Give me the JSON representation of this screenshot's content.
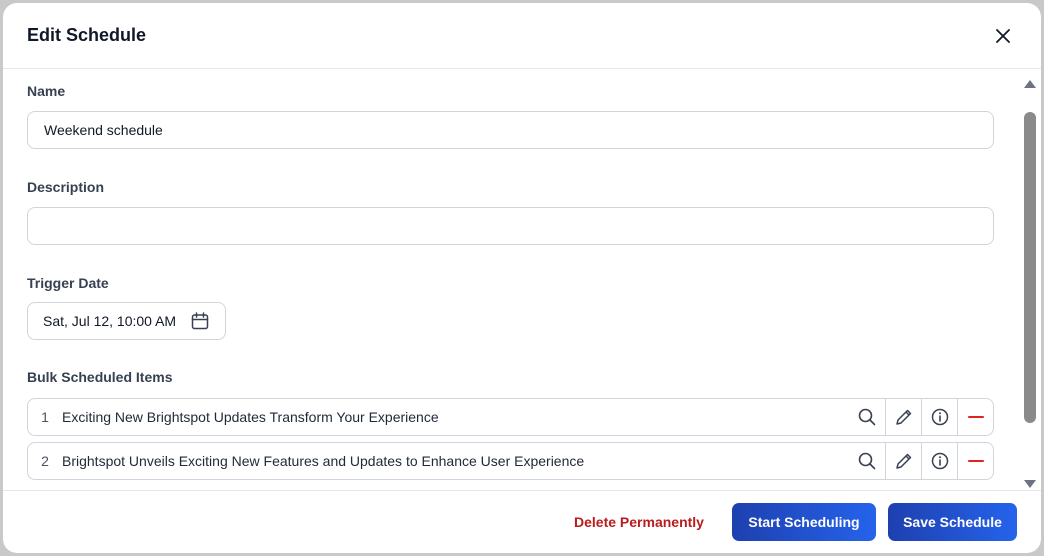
{
  "dialog": {
    "title": "Edit Schedule"
  },
  "form": {
    "name_label": "Name",
    "name_value": "Weekend schedule",
    "description_label": "Description",
    "description_value": "",
    "trigger_label": "Trigger Date",
    "trigger_value": "Sat, Jul 12, 10:00 AM",
    "bulk_label": "Bulk Scheduled Items"
  },
  "items": [
    {
      "num": "1",
      "title": "Exciting New Brightspot Updates Transform Your Experience"
    },
    {
      "num": "2",
      "title": "Brightspot Unveils Exciting New Features and Updates to Enhance User Experience"
    }
  ],
  "footer": {
    "delete_label": "Delete Permanently",
    "start_label": "Start Scheduling",
    "save_label": "Save Schedule"
  },
  "colors": {
    "primary": "#1d4ed8",
    "danger": "#b91c1c"
  },
  "icons": [
    "close-icon",
    "calendar-icon",
    "search-icon",
    "pencil-icon",
    "info-icon",
    "minus-icon"
  ]
}
